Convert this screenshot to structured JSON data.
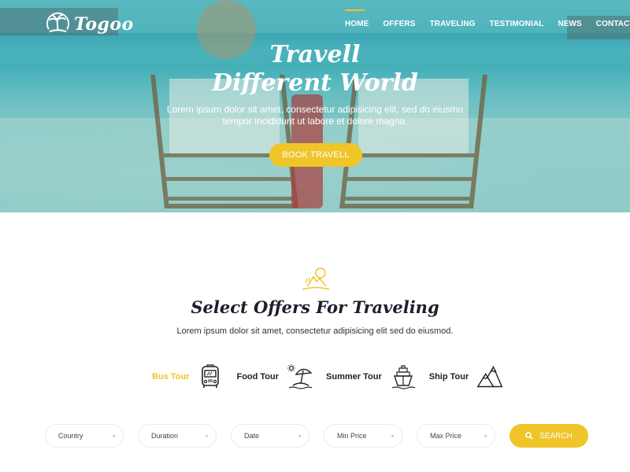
{
  "brand": {
    "name": "Togoo",
    "logo_icon": "palm-tree-island-icon"
  },
  "nav": {
    "items": [
      {
        "label": "HOME",
        "active": true
      },
      {
        "label": "OFFERS",
        "active": false
      },
      {
        "label": "TRAVELING",
        "active": false
      },
      {
        "label": "TESTIMONIAL",
        "active": false
      },
      {
        "label": "NEWS",
        "active": false
      },
      {
        "label": "CONTACT",
        "active": false
      }
    ]
  },
  "hero": {
    "title_line1": "Travell",
    "title_line2": "Different World",
    "text": "Lorem ipsum dolor sit amet, consectetur adipisicing elit, sed do eiusmo tempor incididunt ut labore et dolore magna.",
    "button_label": "BOOK TRAVELL"
  },
  "offers": {
    "icon": "beach-sun-icon",
    "title": "Select Offers For Traveling",
    "subtitle": "Lorem ipsum dolor sit amet, consectetur adipisicing elit sed do eiusmod.",
    "tabs": [
      {
        "label": "Bus Tour",
        "icon": "bus-icon",
        "active": true
      },
      {
        "label": "Food Tour",
        "icon": "beach-umbrella-icon",
        "active": false
      },
      {
        "label": "Summer Tour",
        "icon": "ship-icon",
        "active": false
      },
      {
        "label": "Ship Tour",
        "icon": "mountain-icon",
        "active": false
      }
    ]
  },
  "search": {
    "fields": [
      {
        "label": "Country"
      },
      {
        "label": "Duration"
      },
      {
        "label": "Date"
      },
      {
        "label": "Min Price"
      },
      {
        "label": "Max Price"
      }
    ],
    "button_label": "SEARCH"
  },
  "colors": {
    "accent": "#efc52a",
    "heading": "#1b1f2a",
    "hero_overlay": "#3eaab2"
  }
}
